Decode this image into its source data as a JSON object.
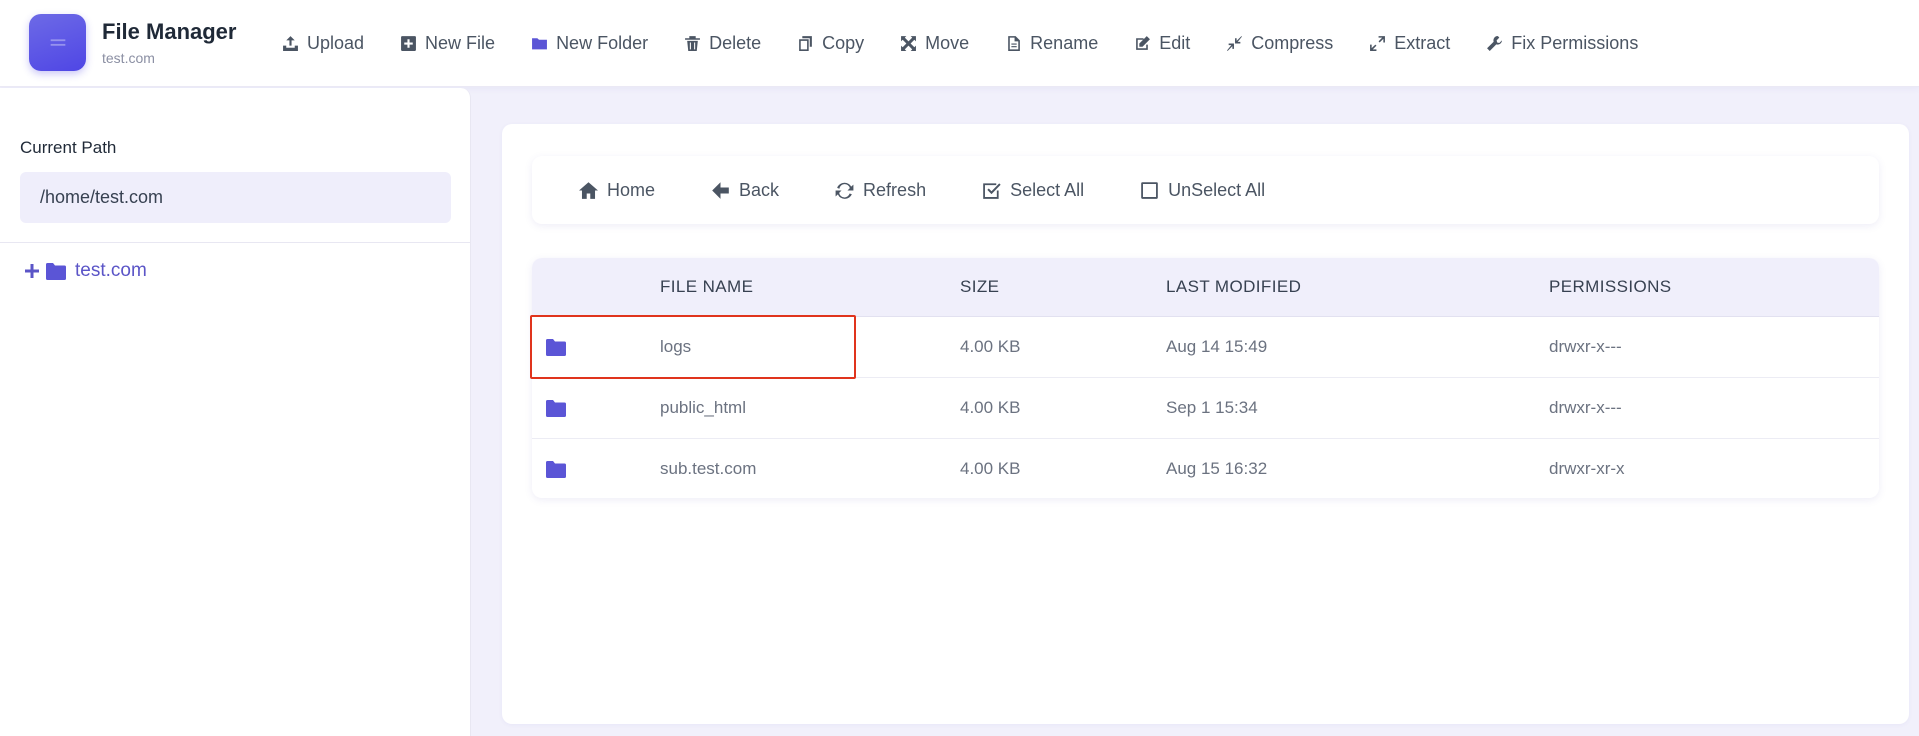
{
  "app": {
    "title": "File Manager",
    "domain": "test.com"
  },
  "toolbar": {
    "items": [
      {
        "label": "Upload",
        "icon": "upload-icon"
      },
      {
        "label": "New File",
        "icon": "plus-square-icon"
      },
      {
        "label": "New Folder",
        "icon": "folder-icon"
      },
      {
        "label": "Delete",
        "icon": "trash-icon"
      },
      {
        "label": "Copy",
        "icon": "copy-icon"
      },
      {
        "label": "Move",
        "icon": "arrows-icon"
      },
      {
        "label": "Rename",
        "icon": "file-text-icon"
      },
      {
        "label": "Edit",
        "icon": "edit-icon"
      },
      {
        "label": "Compress",
        "icon": "compress-icon"
      },
      {
        "label": "Extract",
        "icon": "expand-icon"
      },
      {
        "label": "Fix Permissions",
        "icon": "wrench-icon"
      }
    ]
  },
  "sidebar": {
    "current_path_label": "Current Path",
    "current_path_value": "/home/test.com",
    "tree": [
      {
        "label": "test.com"
      }
    ]
  },
  "nav": {
    "home": "Home",
    "back": "Back",
    "refresh": "Refresh",
    "select_all": "Select All",
    "unselect_all": "UnSelect All"
  },
  "table": {
    "headers": {
      "name": "FILE NAME",
      "size": "SIZE",
      "modified": "LAST MODIFIED",
      "permissions": "PERMISSIONS"
    },
    "rows": [
      {
        "name": "logs",
        "size": "4.00 KB",
        "modified": "Aug 14 15:49",
        "permissions": "drwxr-x---"
      },
      {
        "name": "public_html",
        "size": "4.00 KB",
        "modified": "Sep 1 15:34",
        "permissions": "drwxr-x---"
      },
      {
        "name": "sub.test.com",
        "size": "4.00 KB",
        "modified": "Aug 15 16:32",
        "permissions": "drwxr-xr-x"
      }
    ]
  },
  "colors": {
    "accent": "#5b55c7",
    "folder": "#5b55d6",
    "highlight": "#e0341d"
  }
}
